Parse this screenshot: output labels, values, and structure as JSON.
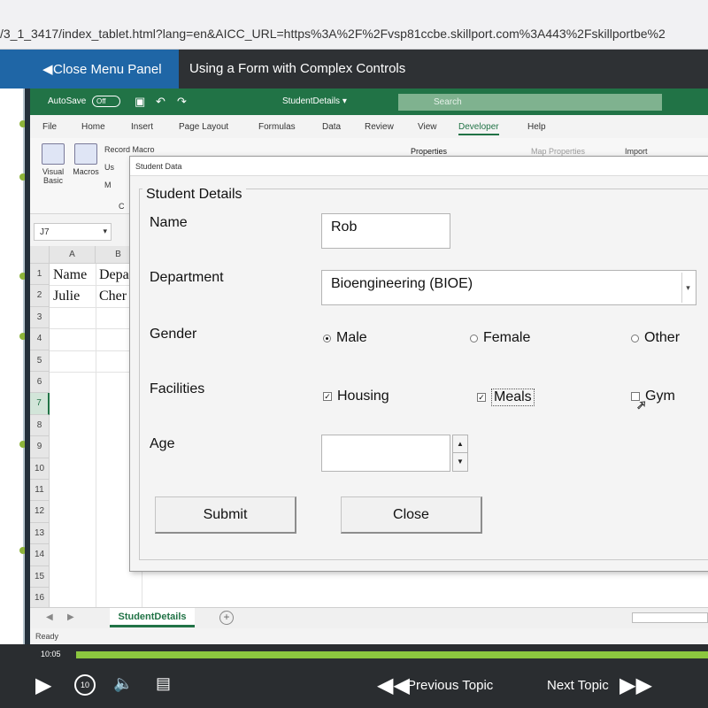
{
  "browser": {
    "url": "/3_1_3417/index_tablet.html?lang=en&AICC_URL=https%3A%2F%2Fvsp81ccbe.skillport.com%3A443%2Fskillportbe%2"
  },
  "player": {
    "close_menu_label": "Close Menu Panel",
    "topic_title": "Using a Form with Complex Controls",
    "time": "10:05",
    "progress": 1.0,
    "previous_topic_label": "Previous Topic",
    "next_topic_label": "Next Topic",
    "replay_label": "10"
  },
  "excel": {
    "autosave_label": "AutoSave",
    "autosave_state": "Off",
    "doc_name": "StudentDetails ▾",
    "search_placeholder": "Search",
    "tabs": [
      "File",
      "Home",
      "Insert",
      "Page Layout",
      "Formulas",
      "Data",
      "Review",
      "View",
      "Developer",
      "Help"
    ],
    "active_tab": "Developer",
    "ribbon": {
      "visual_basic": "Visual Basic",
      "macros": "Macros",
      "record_macro": "Record Macro",
      "use_relative": "Us",
      "macro_security": "M",
      "code_group": "C",
      "properties": "Properties",
      "map_properties": "Map Properties",
      "import": "Import"
    },
    "name_box": "J7",
    "columns": [
      "A",
      "B"
    ],
    "rows": [
      "1",
      "2",
      "3",
      "4",
      "5",
      "6",
      "7",
      "8",
      "9",
      "10",
      "11",
      "12",
      "13",
      "14",
      "15",
      "16"
    ],
    "selected_row": "7",
    "cells": {
      "a1": "Name",
      "b1": "Depa",
      "a2": "Julie",
      "b2": "Cher"
    },
    "sheet_tab": "StudentDetails",
    "status": "Ready"
  },
  "dialog": {
    "title": "Student Data",
    "frame_label": "Student Details",
    "name_label": "Name",
    "name_value": "Rob",
    "department_label": "Department",
    "department_value": "Bioengineering (BIOE)",
    "gender_label": "Gender",
    "gender_options": [
      "Male",
      "Female",
      "Other"
    ],
    "gender_selected": "Male",
    "facilities_label": "Facilities",
    "facilities": [
      {
        "label": "Housing",
        "checked": true
      },
      {
        "label": "Meals",
        "checked": true
      },
      {
        "label": "Gym",
        "checked": false
      }
    ],
    "age_label": "Age",
    "age_value": "",
    "submit_label": "Submit",
    "close_label": "Close"
  },
  "colors": {
    "excel_green": "#217346",
    "player_blue": "#1f66a6",
    "progress_green": "#8cc63f",
    "player_dark": "#2a2d30"
  }
}
